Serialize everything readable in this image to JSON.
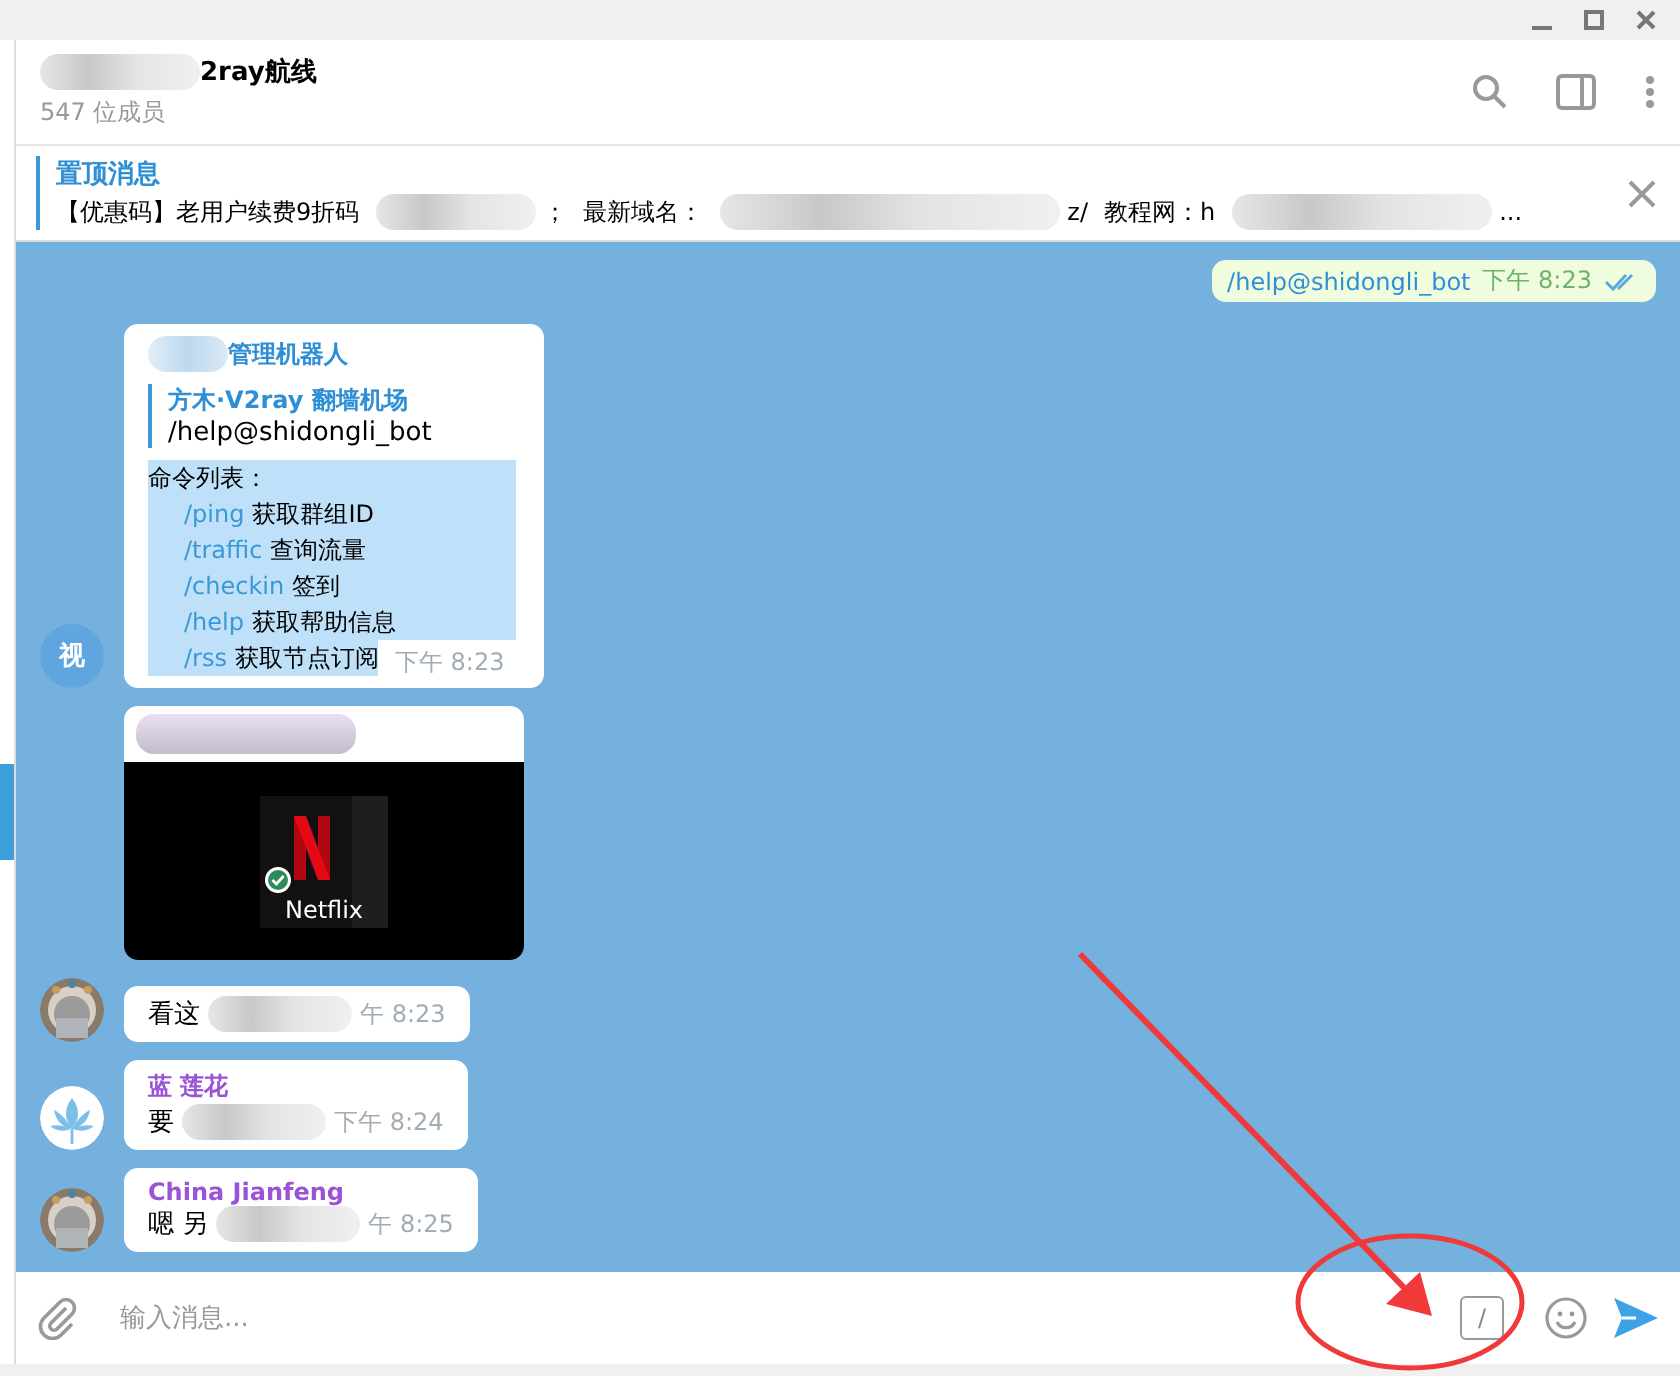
{
  "header": {
    "title": "2ray航线",
    "title_redacted": true,
    "members": "547 位成员"
  },
  "pinned": {
    "title": "置顶消息",
    "parts": [
      {
        "text": "【优惠码】老用户续费9折码",
        "redacted_after": true
      },
      {
        "text": "；",
        "redacted_after": false
      },
      {
        "text": "最新域名：",
        "redacted_after": true
      },
      {
        "text": "z/",
        "redacted_after": false
      },
      {
        "text": "教程网：h",
        "redacted_after": true
      },
      {
        "text": "...",
        "redacted_after": false
      }
    ]
  },
  "messages": [
    {
      "kind": "outgoing",
      "text": "/help@shidongli_bot",
      "time": "下午 8:23",
      "read": true
    },
    {
      "kind": "bot",
      "sender": "管理机器人",
      "sender_redacted": true,
      "avatar": {
        "kind": "initial",
        "text": "视"
      },
      "reply": {
        "title": "方木·V2ray 翻墙机场",
        "text": "/help@shidongli_bot"
      },
      "list_title": "命令列表：",
      "highlighted": true,
      "commands": [
        {
          "command": "/ping",
          "description": "获取群组ID"
        },
        {
          "command": "/traffic",
          "description": "查询流量"
        },
        {
          "command": "/checkin",
          "description": "签到"
        },
        {
          "command": "/help",
          "description": "获取帮助信息"
        },
        {
          "command": "/rss",
          "description": "获取节点订阅"
        }
      ],
      "time": "下午 8:23"
    },
    {
      "sender_redacted": true,
      "caption": "Netflix",
      "checked": true
    },
    {
      "kind": "text",
      "text": "看这",
      "redacted": true,
      "time": "午 8:23"
    },
    {
      "kind": "text",
      "avatar": {
        "kind": "lotus"
      },
      "sender": "蓝 莲花",
      "text": "要",
      "redacted": true,
      "time": "下午 8:24"
    },
    {
      "kind": "text",
      "sender": "China Jianfeng",
      "text": "嗯 另",
      "redacted": true,
      "time": "午 8:25"
    }
  ],
  "composer": {
    "placeholder": "输入消息...",
    "command_key": "/"
  }
}
